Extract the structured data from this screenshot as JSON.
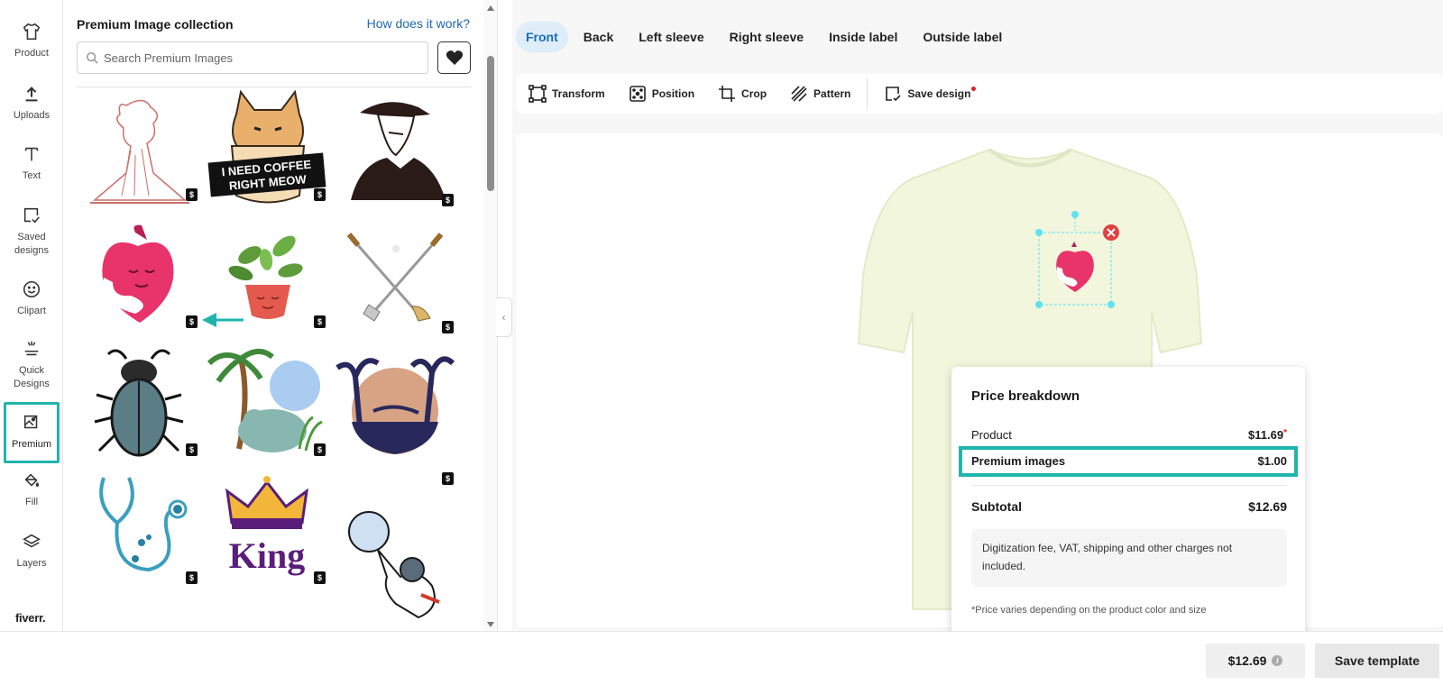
{
  "rail": {
    "items": [
      {
        "label": "Product",
        "icon": "shirt-icon"
      },
      {
        "label": "Uploads",
        "icon": "upload-icon"
      },
      {
        "label": "Text",
        "icon": "text-icon"
      },
      {
        "label": "Saved designs",
        "icon": "saved-designs-icon"
      },
      {
        "label": "Clipart",
        "icon": "smiley-icon"
      },
      {
        "label": "Quick Designs",
        "icon": "magic-icon"
      },
      {
        "label": "Premium",
        "icon": "premium-image-icon"
      },
      {
        "label": "Fill",
        "icon": "paint-bucket-icon"
      },
      {
        "label": "Layers",
        "icon": "layers-icon"
      }
    ],
    "logo": "fiverr."
  },
  "panel": {
    "title": "Premium Image collection",
    "help_link": "How does it work?",
    "search_placeholder": "Search Premium Images",
    "tiles": [
      {
        "name": "volcano",
        "price_badge": "$"
      },
      {
        "name": "coffee-cat",
        "caption": "I NEED COFFEE RIGHT MEOW",
        "price_badge": "$"
      },
      {
        "name": "detective-man",
        "price_badge": "$"
      },
      {
        "name": "hugging-heart",
        "price_badge": "$"
      },
      {
        "name": "plant-pot",
        "price_badge": "$"
      },
      {
        "name": "golf-clubs",
        "price_badge": "$"
      },
      {
        "name": "beetle",
        "price_badge": "$"
      },
      {
        "name": "koala-palm",
        "price_badge": "$"
      },
      {
        "name": "tropical-sunset",
        "price_badge": "$"
      },
      {
        "name": "stethoscope",
        "price_badge": "$"
      },
      {
        "name": "king-crown",
        "caption": "King",
        "price_badge": "$"
      },
      {
        "name": "astronaut",
        "price_badge": "$"
      }
    ]
  },
  "views": [
    "Front",
    "Back",
    "Left sleeve",
    "Right sleeve",
    "Inside label",
    "Outside label"
  ],
  "toolbar": [
    "Transform",
    "Position",
    "Crop",
    "Pattern",
    "Save design"
  ],
  "price_breakdown": {
    "title": "Price breakdown",
    "product_label": "Product",
    "product_value": "$11.69",
    "premium_label": "Premium images",
    "premium_value": "$1.00",
    "subtotal_label": "Subtotal",
    "subtotal_value": "$12.69",
    "note": "Digitization fee, VAT, shipping and other charges not included.",
    "footnote": "*Price varies depending on the product color and size"
  },
  "bottom": {
    "price": "$12.69",
    "save_label": "Save template"
  },
  "colors": {
    "accent": "#1fb5ad",
    "shirt": "#f1f6dc",
    "heart": "#e8336b",
    "link": "#1d68b5"
  }
}
